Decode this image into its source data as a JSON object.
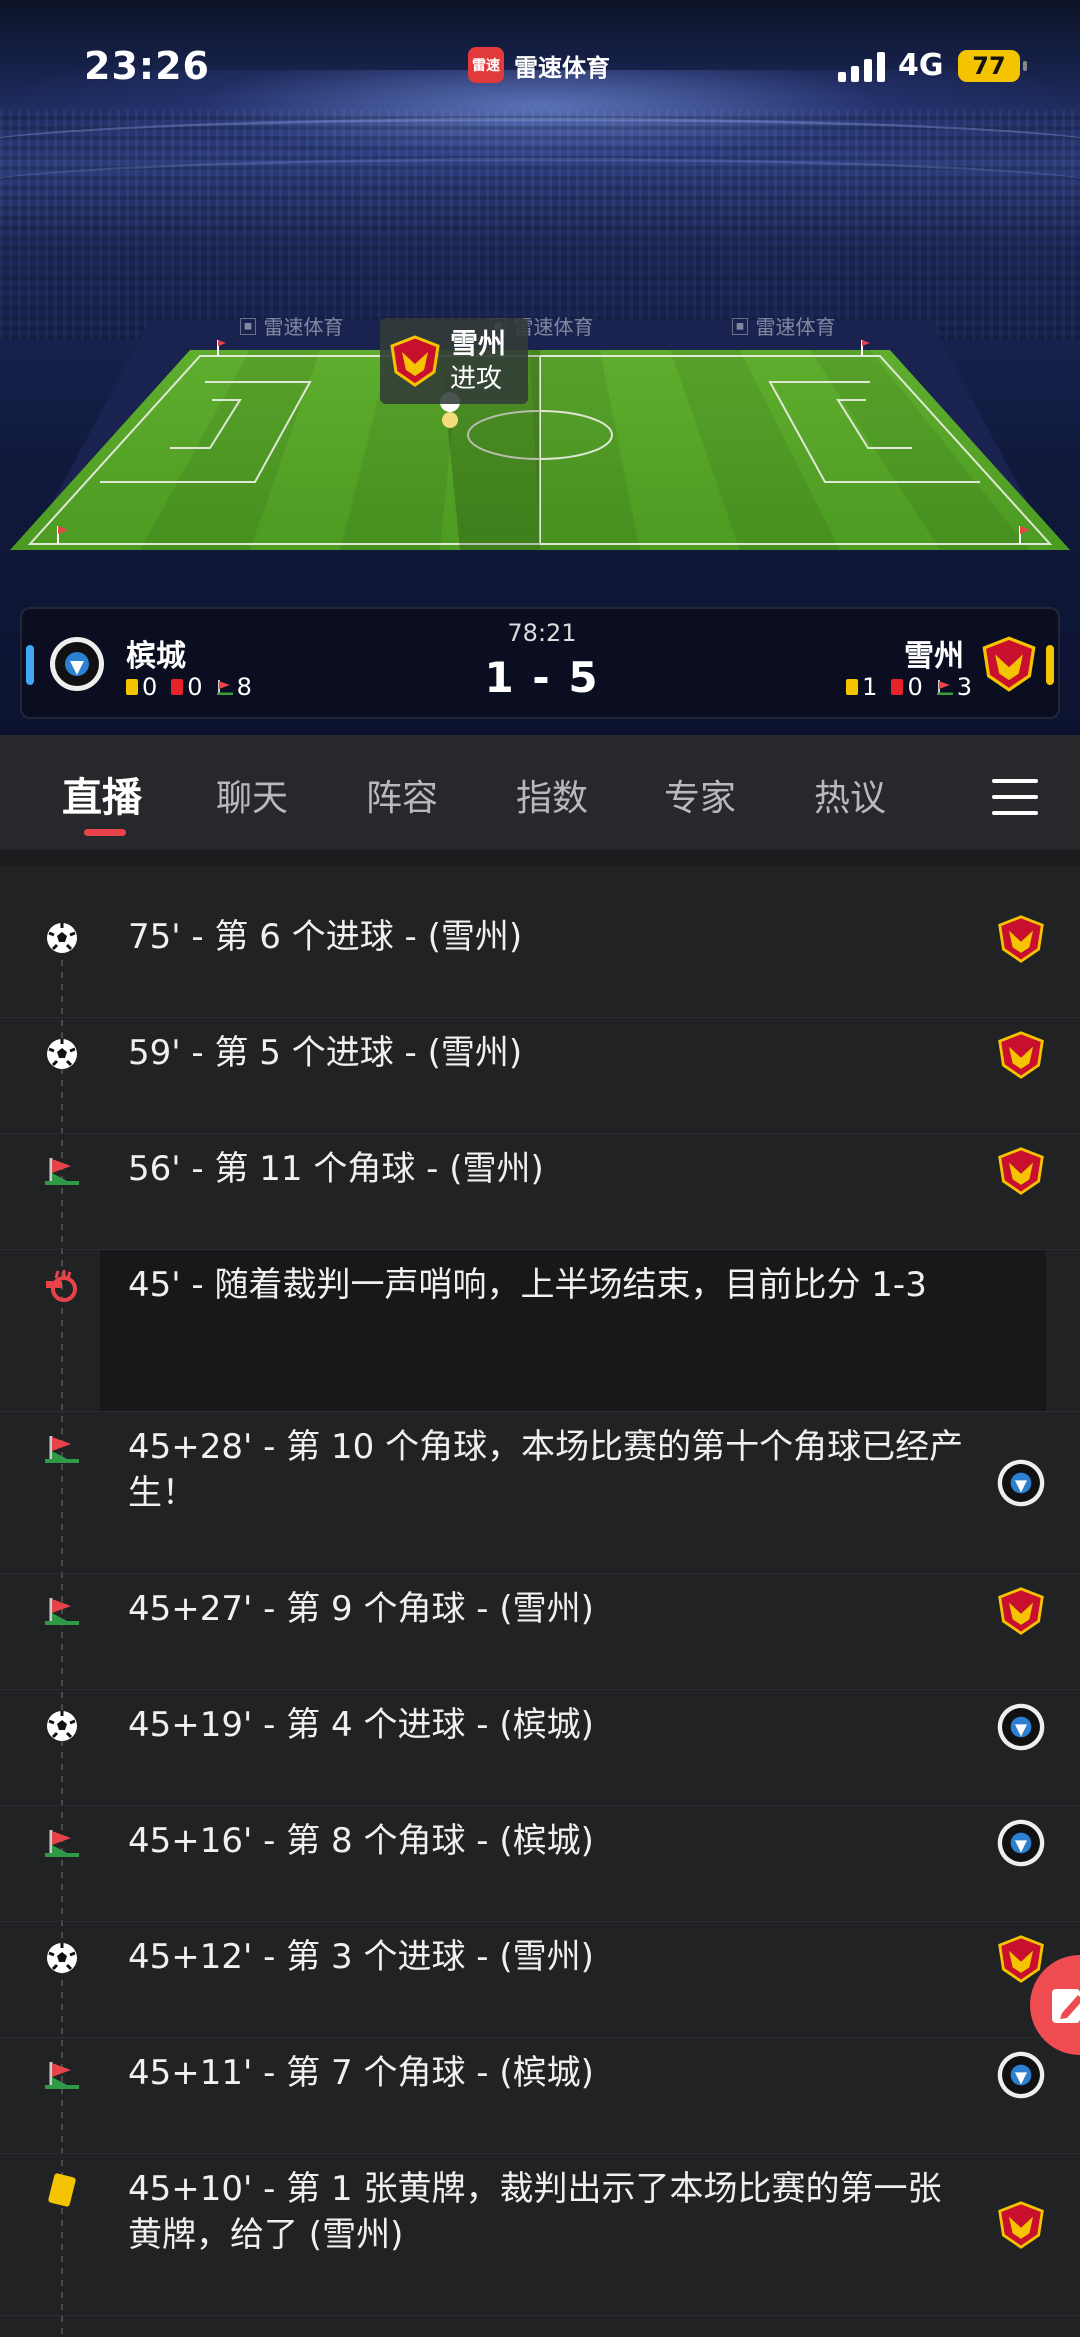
{
  "status_bar": {
    "time": "23:26",
    "app_logo_text": "雷速",
    "app_name": "雷速体育",
    "network": "4G",
    "battery": "77"
  },
  "pitch": {
    "ad_text": "雷速体育",
    "attacking_team": "雪州",
    "attacking_state": "进攻"
  },
  "match": {
    "time": "78:21",
    "score": "1 - 5",
    "home": {
      "name": "槟城",
      "yellow": "0",
      "red": "0",
      "corners": "8",
      "color": "#3fa9f5"
    },
    "away": {
      "name": "雪州",
      "yellow": "1",
      "red": "0",
      "corners": "3",
      "color": "#f5c400"
    }
  },
  "tabs": [
    {
      "label": "直播",
      "active": true
    },
    {
      "label": "聊天"
    },
    {
      "label": "阵容"
    },
    {
      "label": "指数"
    },
    {
      "label": "专家"
    },
    {
      "label": "热议"
    }
  ],
  "events": [
    {
      "icon": "soccer-ball-icon",
      "text": "75' - 第 6 个进球 - (雪州)",
      "team": "away"
    },
    {
      "icon": "soccer-ball-icon",
      "text": "59' - 第 5 个进球 - (雪州)",
      "team": "away"
    },
    {
      "icon": "corner-flag-icon",
      "text": "56' - 第 11 个角球 - (雪州)",
      "team": "away"
    },
    {
      "icon": "whistle-icon",
      "text": "45' - 随着裁判一声哨响，上半场结束，目前比分 1-3",
      "team": "none"
    },
    {
      "icon": "corner-flag-icon",
      "text": "45+28' - 第 10 个角球，本场比赛的第十个角球已经产生！",
      "team": "home"
    },
    {
      "icon": "corner-flag-icon",
      "text": "45+27' - 第 9 个角球 - (雪州)",
      "team": "away"
    },
    {
      "icon": "soccer-ball-icon",
      "text": "45+19' - 第 4 个进球 - (槟城)",
      "team": "home"
    },
    {
      "icon": "corner-flag-icon",
      "text": "45+16' - 第 8 个角球 - (槟城)",
      "team": "home"
    },
    {
      "icon": "soccer-ball-icon",
      "text": "45+12' - 第 3 个进球 - (雪州)",
      "team": "away"
    },
    {
      "icon": "corner-flag-icon",
      "text": "45+11' - 第 7 个角球 - (槟城)",
      "team": "home"
    },
    {
      "icon": "yellow-card-icon",
      "text": "45+10' - 第 1 张黄牌，裁判出示了本场比赛的第一张黄牌，给了 (雪州)",
      "team": "away"
    }
  ]
}
